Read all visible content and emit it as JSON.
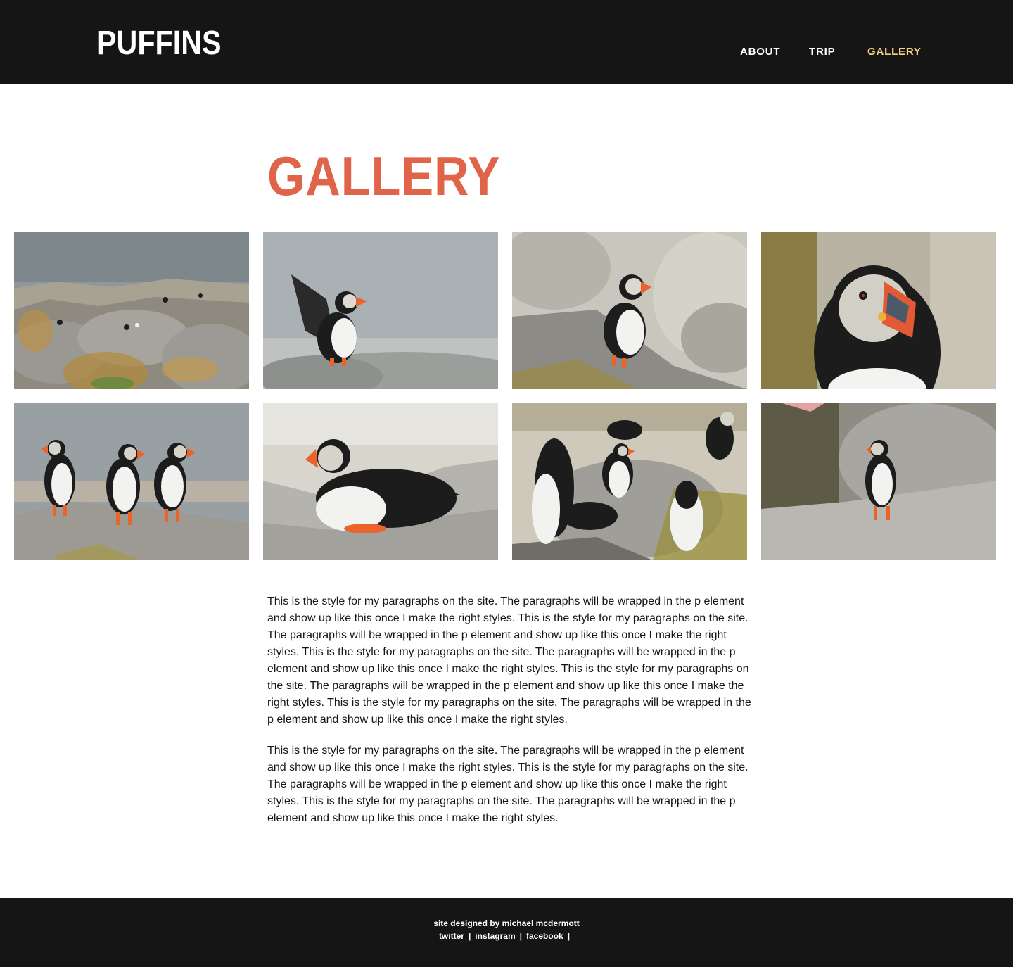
{
  "header": {
    "logo": "PUFFINS",
    "nav": [
      {
        "label": "ABOUT",
        "active": false
      },
      {
        "label": "TRIP",
        "active": false
      },
      {
        "label": "GALLERY",
        "active": true
      }
    ]
  },
  "main": {
    "title": "GALLERY",
    "paragraphs": [
      "This is the style for my paragraphs on the site. The paragraphs will be wrapped in the p element and show up like this once I make the right styles. This is the style for my paragraphs on the site. The paragraphs will be wrapped in the p element and show up like this once I make the right styles. This is the style for my paragraphs on the site. The paragraphs will be wrapped in the p element and show up like this once I make the right styles. This is the style for my paragraphs on the site. The paragraphs will be wrapped in the p element and show up like this once I make the right styles. This is the style for my paragraphs on the site. The paragraphs will be wrapped in the p element and show up like this once I make the right styles.",
      "This is the style for my paragraphs on the site. The paragraphs will be wrapped in the p element and show up like this once I make the right styles. This is the style for my paragraphs on the site. The paragraphs will be wrapped in the p element and show up like this once I make the right styles. This is the style for my paragraphs on the site. The paragraphs will be wrapped in the p element and show up like this once I make the right styles."
    ]
  },
  "footer": {
    "credit": "site designed by michael mcdermott",
    "links": [
      "twitter",
      "instagram",
      "facebook"
    ],
    "separator": "|"
  },
  "colors": {
    "header_bg": "#151515",
    "accent": "#e0644a",
    "nav_active": "#f6d381",
    "text": "#151515"
  }
}
